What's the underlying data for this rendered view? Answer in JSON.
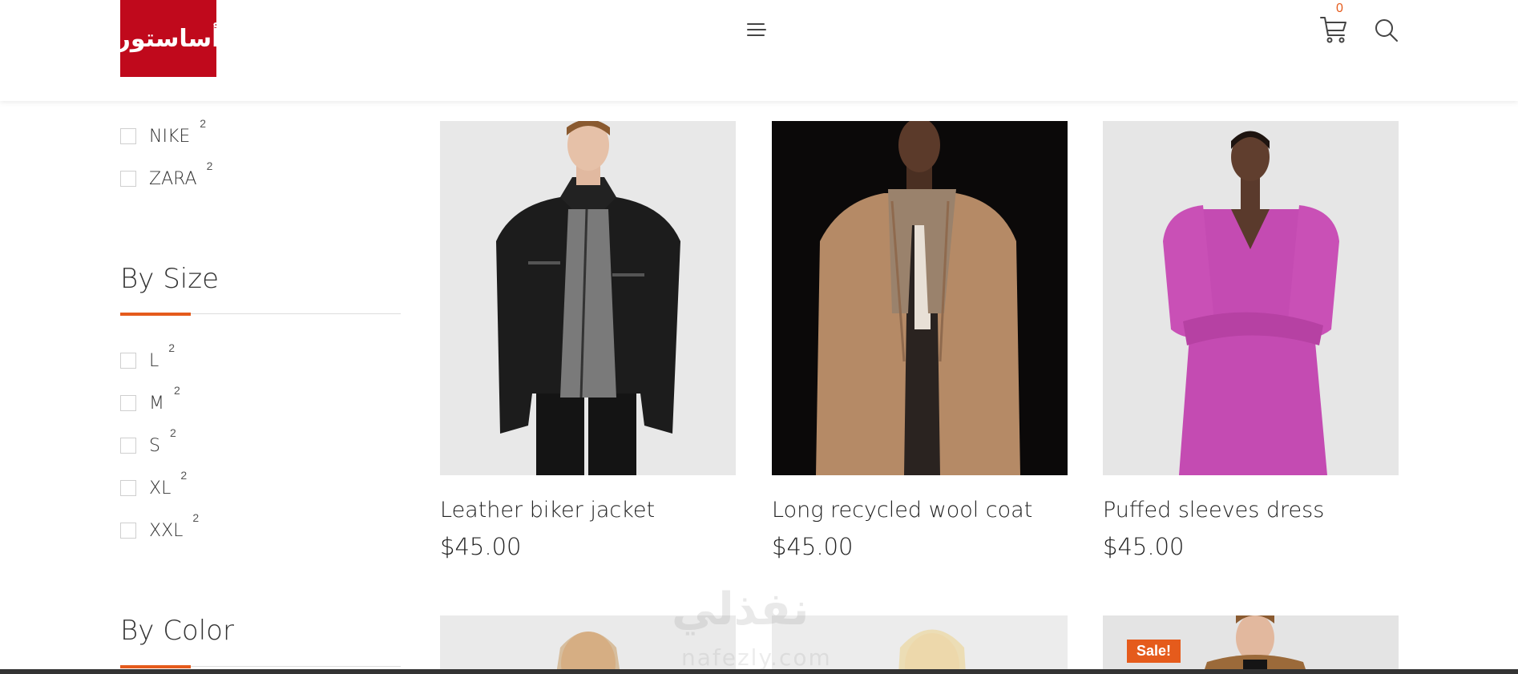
{
  "header": {
    "logo_text": "أساستور",
    "cart_count": "0",
    "icons": {
      "menu": "hamburger-menu-icon",
      "cart": "shopping-cart-icon",
      "search": "search-icon"
    }
  },
  "sidebar": {
    "brands": [
      {
        "label": "NIKE",
        "count": "2"
      },
      {
        "label": "ZARA",
        "count": "2"
      }
    ],
    "by_size": {
      "title": "By Size",
      "items": [
        {
          "label": "L",
          "count": "2"
        },
        {
          "label": "M",
          "count": "2"
        },
        {
          "label": "S",
          "count": "2"
        },
        {
          "label": "XL",
          "count": "2"
        },
        {
          "label": "XXL",
          "count": "2"
        }
      ]
    },
    "by_color": {
      "title": "By Color"
    }
  },
  "products": [
    {
      "name": "Leather biker jacket",
      "price": "$45.00"
    },
    {
      "name": "Long recycled wool coat",
      "price": "$45.00"
    },
    {
      "name": "Puffed sleeves dress",
      "price": "$45.00"
    }
  ],
  "partial_products": [
    {
      "badge": ""
    },
    {
      "badge": ""
    },
    {
      "badge": "Sale!"
    }
  ],
  "watermark": {
    "arabic": "نفذلي",
    "latin": "nafezly.com"
  },
  "colors": {
    "brand_red": "#c0091c",
    "accent_orange": "#e55b1c"
  }
}
